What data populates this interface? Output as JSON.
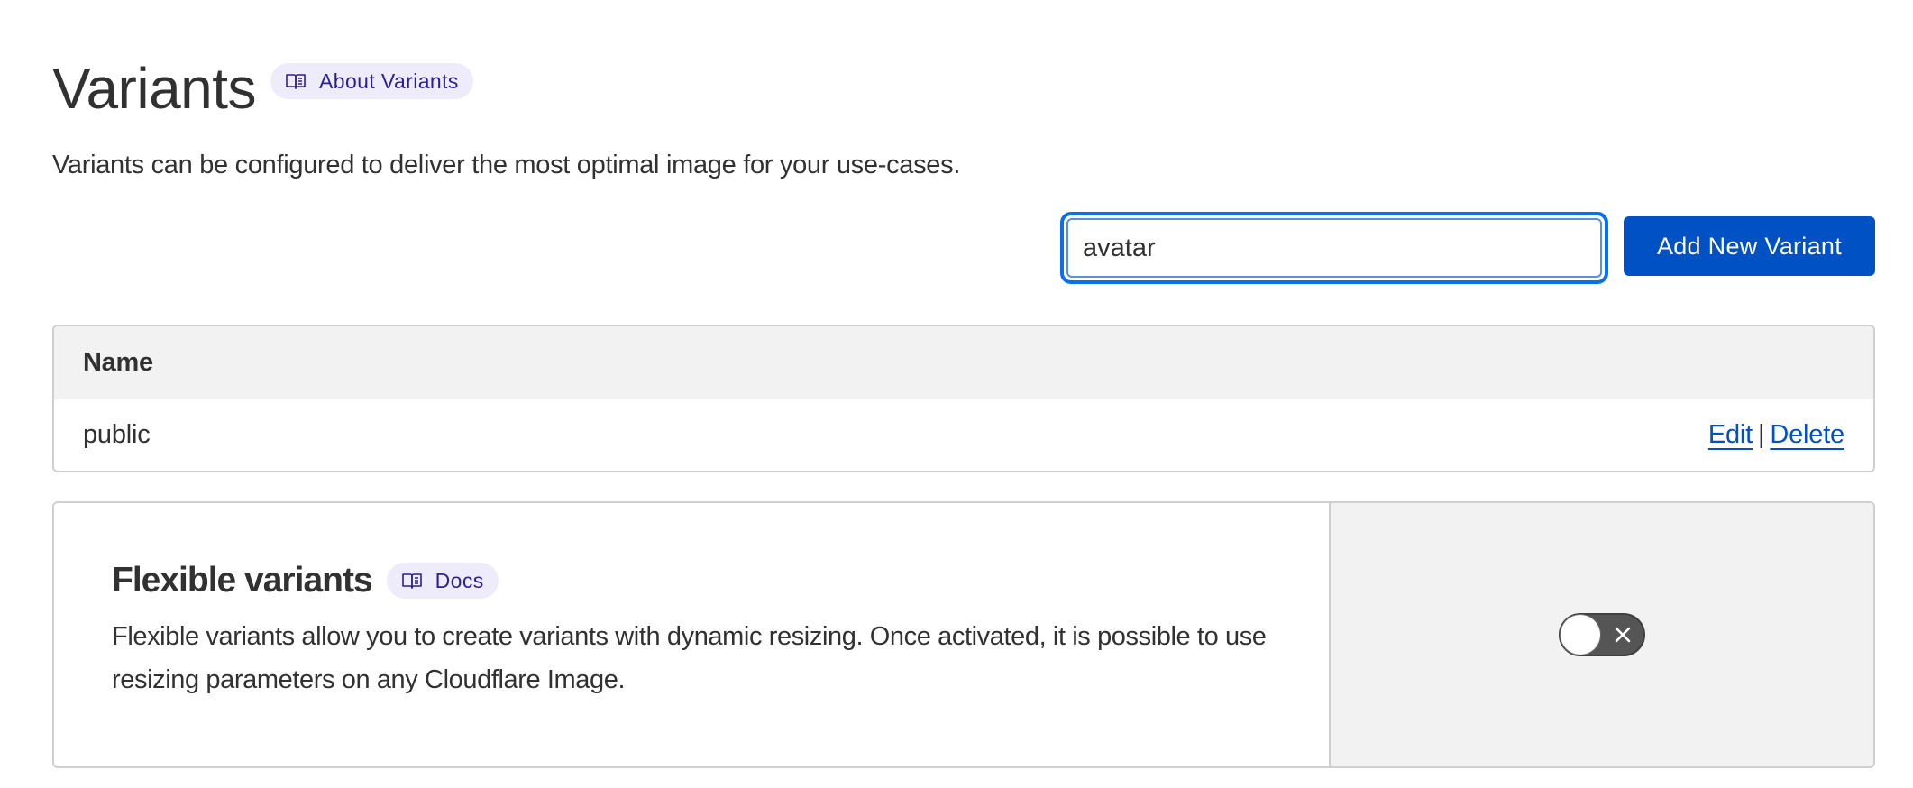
{
  "header": {
    "title": "Variants",
    "about_link_label": "About Variants"
  },
  "description": "Variants can be configured to deliver the most optimal image for your use-cases.",
  "search": {
    "value": "avatar",
    "placeholder": ""
  },
  "add_button_label": "Add New Variant",
  "table": {
    "columns": [
      "Name"
    ],
    "rows": [
      {
        "name": "public",
        "edit_label": "Edit",
        "separator": "|",
        "delete_label": "Delete"
      }
    ]
  },
  "flexible_variants": {
    "title": "Flexible variants",
    "docs_label": "Docs",
    "description": "Flexible variants allow you to create variants with dynamic resizing. Once activated, it is possible to use resizing parameters on any Cloudflare Image.",
    "enabled": false
  },
  "colors": {
    "accent": "#0051c3",
    "focus_ring": "#0a6ef0",
    "pill_background": "#eeecfb",
    "pill_text": "#2c1f8f",
    "toggle_off": "#555555"
  },
  "icons": {
    "doc_link": "book-icon",
    "toggle_off": "close-icon"
  }
}
